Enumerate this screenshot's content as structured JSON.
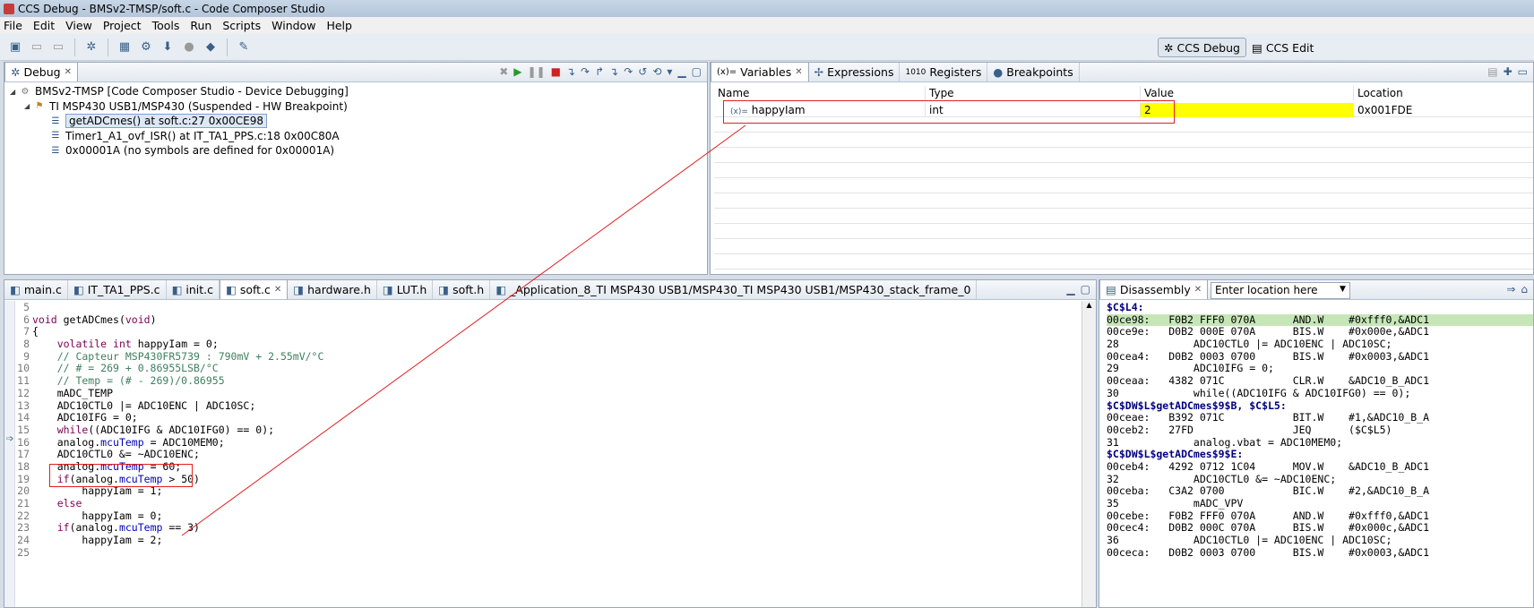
{
  "window": {
    "title": "CCS Debug - BMSv2-TMSP/soft.c - Code Composer Studio"
  },
  "menu": [
    "File",
    "Edit",
    "View",
    "Project",
    "Tools",
    "Run",
    "Scripts",
    "Window",
    "Help"
  ],
  "perspectives": {
    "debug": "CCS Debug",
    "edit": "CCS Edit"
  },
  "debug_view": {
    "tab": "Debug",
    "items": [
      "BMSv2-TMSP [Code Composer Studio - Device Debugging]",
      "TI MSP430 USB1/MSP430 (Suspended - HW Breakpoint)",
      "getADCmes() at soft.c:27 0x00CE98",
      "Timer1_A1_ovf_ISR() at IT_TA1_PPS.c:18 0x00C80A",
      "0x00001A  (no symbols are defined for 0x00001A)"
    ]
  },
  "variables_view": {
    "tabs": [
      "Variables",
      "Expressions",
      "Registers",
      "Breakpoints"
    ],
    "columns": [
      "Name",
      "Type",
      "Value",
      "Location"
    ],
    "rows": [
      {
        "name": "happyIam",
        "type": "int",
        "value": "2",
        "location": "0x001FDE"
      }
    ],
    "value_highlight": "#ffff00"
  },
  "editor": {
    "tabs": [
      "main.c",
      "IT_TA1_PPS.c",
      "init.c",
      "soft.c",
      "hardware.h",
      "LUT.h",
      "soft.h",
      "_Application_8_TI MSP430 USB1/MSP430_TI MSP430 USB1/MSP430_stack_frame_0"
    ],
    "active_tab": "soft.c",
    "lines": [
      {
        "n": "5",
        "t": ""
      },
      {
        "n": "6",
        "t": "void getADCmes(void)"
      },
      {
        "n": "7",
        "t": "{"
      },
      {
        "n": "8",
        "t": "    volatile int happyIam = 0;"
      },
      {
        "n": "9",
        "t": "    // Capteur MSP430FR5739 : 790mV + 2.55mV/°C"
      },
      {
        "n": "10",
        "t": "    // # = 269 + 0.86955LSB/°C"
      },
      {
        "n": "11",
        "t": "    // Temp = (# - 269)/0.86955"
      },
      {
        "n": "12",
        "t": "    mADC_TEMP"
      },
      {
        "n": "13",
        "t": "    ADC10CTL0 |= ADC10ENC | ADC10SC;"
      },
      {
        "n": "14",
        "t": "    ADC10IFG = 0;"
      },
      {
        "n": "15",
        "t": "    while((ADC10IFG & ADC10IFG0) == 0);"
      },
      {
        "n": "16",
        "t": "    analog.mcuTemp = ADC10MEM0;"
      },
      {
        "n": "17",
        "t": "    ADC10CTL0 &= ~ADC10ENC;"
      },
      {
        "n": "18",
        "t": "    analog.mcuTemp = 60;"
      },
      {
        "n": "19",
        "t": "    if(analog.mcuTemp > 50)"
      },
      {
        "n": "20",
        "t": "        happyIam = 1;"
      },
      {
        "n": "21",
        "t": "    else"
      },
      {
        "n": "22",
        "t": "        happyIam = 0;"
      },
      {
        "n": "23",
        "t": "    if(analog.mcuTemp == 3)"
      },
      {
        "n": "24",
        "t": "        happyIam = 2;"
      },
      {
        "n": "25",
        "t": ""
      }
    ]
  },
  "disassembly": {
    "tab": "Disassembly",
    "location_placeholder": "Enter location here",
    "lines": [
      "$C$L4:",
      "00ce98:   F0B2 FFF0 070A      AND.W    #0xfff0,&ADC1",
      "00ce9e:   D0B2 000E 070A      BIS.W    #0x000e,&ADC1",
      "28            ADC10CTL0 |= ADC10ENC | ADC10SC;",
      "00cea4:   D0B2 0003 0700      BIS.W    #0x0003,&ADC1",
      "29            ADC10IFG = 0;",
      "00ceaa:   4382 071C           CLR.W    &ADC10_B_ADC1",
      "30            while((ADC10IFG & ADC10IFG0) == 0);",
      "$C$DW$L$getADCmes$9$B, $C$L5:",
      "00ceae:   B392 071C           BIT.W    #1,&ADC10_B_A",
      "00ceb2:   27FD                JEQ      ($C$L5)",
      "31            analog.vbat = ADC10MEM0;",
      "$C$DW$L$getADCmes$9$E:",
      "00ceb4:   4292 0712 1C04      MOV.W    &ADC10_B_ADC1",
      "32            ADC10CTL0 &= ~ADC10ENC;",
      "00ceba:   C3A2 0700           BIC.W    #2,&ADC10_B_A",
      "35            mADC_VPV",
      "00cebe:   F0B2 FFF0 070A      AND.W    #0xfff0,&ADC1",
      "00cec4:   D0B2 000C 070A      BIS.W    #0x000c,&ADC1",
      "36            ADC10CTL0 |= ADC10ENC | ADC10SC;",
      "00ceca:   D0B2 0003 0700      BIS.W    #0x0003,&ADC1"
    ]
  }
}
